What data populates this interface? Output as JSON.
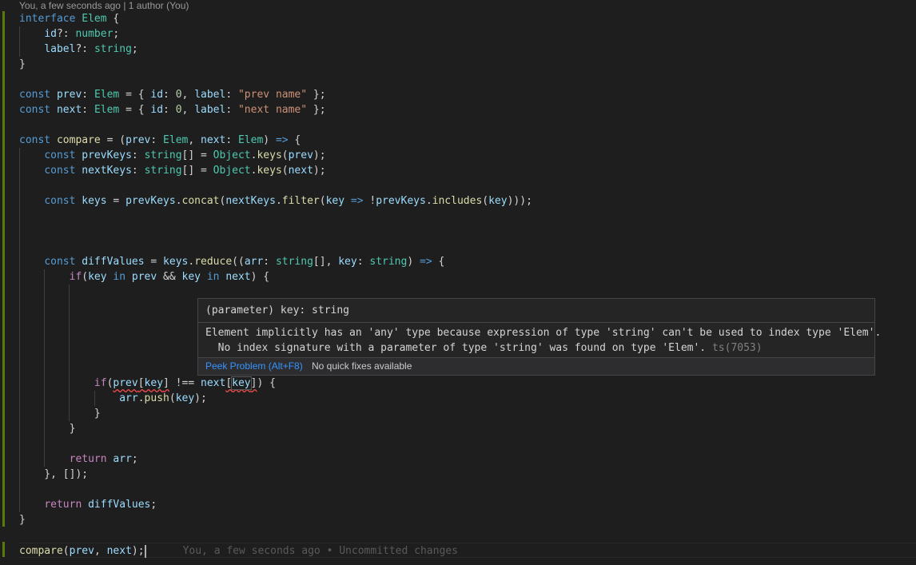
{
  "codelens": "You, a few seconds ago | 1 author (You)",
  "lines": [
    [
      [
        "kw",
        "interface"
      ],
      [
        "pl",
        " "
      ],
      [
        "ty",
        "Elem"
      ],
      [
        "pl",
        " {"
      ]
    ],
    [
      [
        "pl",
        "    "
      ],
      [
        "va",
        "id"
      ],
      [
        "pl",
        "?: "
      ],
      [
        "ty",
        "number"
      ],
      [
        "pl",
        ";"
      ]
    ],
    [
      [
        "pl",
        "    "
      ],
      [
        "va",
        "label"
      ],
      [
        "pl",
        "?: "
      ],
      [
        "ty",
        "string"
      ],
      [
        "pl",
        ";"
      ]
    ],
    [
      [
        "pl",
        "}"
      ]
    ],
    [],
    [
      [
        "kw",
        "const"
      ],
      [
        "pl",
        " "
      ],
      [
        "va",
        "prev"
      ],
      [
        "pl",
        ": "
      ],
      [
        "ty",
        "Elem"
      ],
      [
        "pl",
        " = { "
      ],
      [
        "va",
        "id"
      ],
      [
        "pl",
        ": "
      ],
      [
        "nu",
        "0"
      ],
      [
        "pl",
        ", "
      ],
      [
        "va",
        "label"
      ],
      [
        "pl",
        ": "
      ],
      [
        "st",
        "\"prev name\""
      ],
      [
        "pl",
        " };"
      ]
    ],
    [
      [
        "kw",
        "const"
      ],
      [
        "pl",
        " "
      ],
      [
        "va",
        "next"
      ],
      [
        "pl",
        ": "
      ],
      [
        "ty",
        "Elem"
      ],
      [
        "pl",
        " = { "
      ],
      [
        "va",
        "id"
      ],
      [
        "pl",
        ": "
      ],
      [
        "nu",
        "0"
      ],
      [
        "pl",
        ", "
      ],
      [
        "va",
        "label"
      ],
      [
        "pl",
        ": "
      ],
      [
        "st",
        "\"next name\""
      ],
      [
        "pl",
        " };"
      ]
    ],
    [],
    [
      [
        "kw",
        "const"
      ],
      [
        "pl",
        " "
      ],
      [
        "fn",
        "compare"
      ],
      [
        "pl",
        " = ("
      ],
      [
        "va",
        "prev"
      ],
      [
        "pl",
        ": "
      ],
      [
        "ty",
        "Elem"
      ],
      [
        "pl",
        ", "
      ],
      [
        "va",
        "next"
      ],
      [
        "pl",
        ": "
      ],
      [
        "ty",
        "Elem"
      ],
      [
        "pl",
        ") "
      ],
      [
        "kw",
        "=>"
      ],
      [
        "pl",
        " {"
      ]
    ],
    [
      [
        "pl",
        "    "
      ],
      [
        "kw",
        "const"
      ],
      [
        "pl",
        " "
      ],
      [
        "va",
        "prevKeys"
      ],
      [
        "pl",
        ": "
      ],
      [
        "ty",
        "string"
      ],
      [
        "pl",
        "[] = "
      ],
      [
        "ty",
        "Object"
      ],
      [
        "pl",
        "."
      ],
      [
        "fn",
        "keys"
      ],
      [
        "pl",
        "("
      ],
      [
        "va",
        "prev"
      ],
      [
        "pl",
        ");"
      ]
    ],
    [
      [
        "pl",
        "    "
      ],
      [
        "kw",
        "const"
      ],
      [
        "pl",
        " "
      ],
      [
        "va",
        "nextKeys"
      ],
      [
        "pl",
        ": "
      ],
      [
        "ty",
        "string"
      ],
      [
        "pl",
        "[] = "
      ],
      [
        "ty",
        "Object"
      ],
      [
        "pl",
        "."
      ],
      [
        "fn",
        "keys"
      ],
      [
        "pl",
        "("
      ],
      [
        "va",
        "next"
      ],
      [
        "pl",
        ");"
      ]
    ],
    [],
    [
      [
        "pl",
        "    "
      ],
      [
        "kw",
        "const"
      ],
      [
        "pl",
        " "
      ],
      [
        "va",
        "keys"
      ],
      [
        "pl",
        " = "
      ],
      [
        "va",
        "prevKeys"
      ],
      [
        "pl",
        "."
      ],
      [
        "fn",
        "concat"
      ],
      [
        "pl",
        "("
      ],
      [
        "va",
        "nextKeys"
      ],
      [
        "pl",
        "."
      ],
      [
        "fn",
        "filter"
      ],
      [
        "pl",
        "("
      ],
      [
        "va",
        "key"
      ],
      [
        "pl",
        " "
      ],
      [
        "kw",
        "=>"
      ],
      [
        "pl",
        " !"
      ],
      [
        "va",
        "prevKeys"
      ],
      [
        "pl",
        "."
      ],
      [
        "fn",
        "includes"
      ],
      [
        "pl",
        "("
      ],
      [
        "va",
        "key"
      ],
      [
        "pl",
        ")));"
      ]
    ],
    [],
    [],
    [],
    [
      [
        "pl",
        "    "
      ],
      [
        "kw",
        "const"
      ],
      [
        "pl",
        " "
      ],
      [
        "va",
        "diffValues"
      ],
      [
        "pl",
        " = "
      ],
      [
        "va",
        "keys"
      ],
      [
        "pl",
        "."
      ],
      [
        "fn",
        "reduce"
      ],
      [
        "pl",
        "(("
      ],
      [
        "va",
        "arr"
      ],
      [
        "pl",
        ": "
      ],
      [
        "ty",
        "string"
      ],
      [
        "pl",
        "[], "
      ],
      [
        "va",
        "key"
      ],
      [
        "pl",
        ": "
      ],
      [
        "ty",
        "string"
      ],
      [
        "pl",
        ") "
      ],
      [
        "kw",
        "=>"
      ],
      [
        "pl",
        " {"
      ]
    ],
    [
      [
        "pl",
        "        "
      ],
      [
        "cf",
        "if"
      ],
      [
        "pl",
        "("
      ],
      [
        "va",
        "key"
      ],
      [
        "pl",
        " "
      ],
      [
        "kw",
        "in"
      ],
      [
        "pl",
        " "
      ],
      [
        "va",
        "prev"
      ],
      [
        "pl",
        " && "
      ],
      [
        "va",
        "key"
      ],
      [
        "pl",
        " "
      ],
      [
        "kw",
        "in"
      ],
      [
        "pl",
        " "
      ],
      [
        "va",
        "next"
      ],
      [
        "pl",
        ") {"
      ]
    ],
    [],
    [],
    [],
    [],
    [],
    [],
    [
      [
        "pl",
        "            "
      ],
      [
        "cf",
        "if"
      ],
      [
        "pl",
        "("
      ],
      [
        "va squig",
        "prev"
      ],
      [
        "pl squig",
        "["
      ],
      [
        "va squig",
        "key"
      ],
      [
        "pl squig",
        "]"
      ],
      [
        "pl",
        " !== "
      ],
      [
        "va",
        "next"
      ],
      [
        "pl squig",
        "["
      ],
      [
        "va squig highlight-word",
        "key"
      ],
      [
        "pl squig",
        "]"
      ],
      [
        "pl",
        ") {"
      ]
    ],
    [
      [
        "pl",
        "                "
      ],
      [
        "va",
        "arr"
      ],
      [
        "pl",
        "."
      ],
      [
        "fn",
        "push"
      ],
      [
        "pl",
        "("
      ],
      [
        "va",
        "key"
      ],
      [
        "pl",
        ");"
      ]
    ],
    [
      [
        "pl",
        "            }"
      ]
    ],
    [
      [
        "pl",
        "        }"
      ]
    ],
    [],
    [
      [
        "pl",
        "        "
      ],
      [
        "cf",
        "return"
      ],
      [
        "pl",
        " "
      ],
      [
        "va",
        "arr"
      ],
      [
        "pl",
        ";"
      ]
    ],
    [
      [
        "pl",
        "    }, []);"
      ]
    ],
    [],
    [
      [
        "pl",
        "    "
      ],
      [
        "cf",
        "return"
      ],
      [
        "pl",
        " "
      ],
      [
        "va",
        "diffValues"
      ],
      [
        "pl",
        ";"
      ]
    ],
    [
      [
        "pl",
        "}"
      ]
    ],
    [],
    [
      [
        "fn",
        "compare"
      ],
      [
        "pl",
        "("
      ],
      [
        "va",
        "prev"
      ],
      [
        "pl",
        ", "
      ],
      [
        "va",
        "next"
      ],
      [
        "pl",
        ");"
      ]
    ]
  ],
  "blame": "You, a few seconds ago • Uncommitted changes",
  "hover": {
    "signature": "(parameter) key: string",
    "message_line1": "Element implicitly has an 'any' type because expression of type 'string' can't be used to index type 'Elem'.",
    "message_line2": "  No index signature with a parameter of type 'string' was found on type 'Elem'.",
    "code": "ts(7053)",
    "peek_label": "Peek Problem (Alt+F8)",
    "no_fix_label": "No quick fixes available"
  },
  "colors": {
    "background": "#1e1e1e",
    "keyword": "#569cd6",
    "control": "#c586c0",
    "type": "#4ec9b0",
    "variable": "#9cdcfe",
    "function": "#dcdcaa",
    "string": "#ce9178",
    "number": "#b5cea8",
    "gutter_modified": "#587c0c",
    "error": "#f14c4c",
    "link": "#3794ff"
  }
}
